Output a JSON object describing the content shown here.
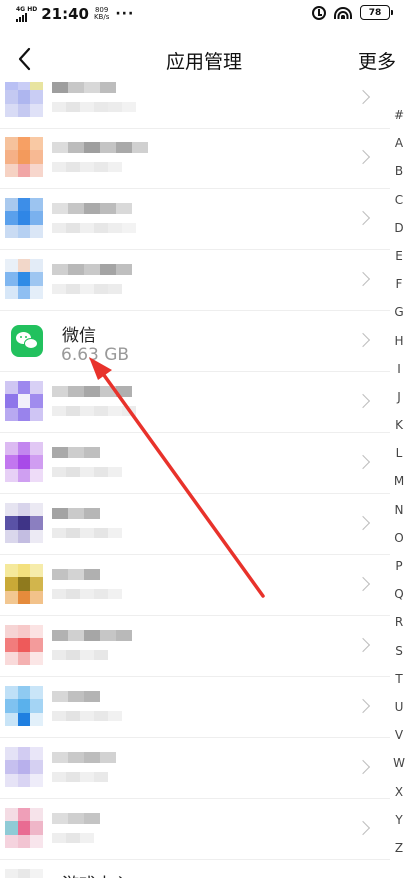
{
  "status_bar": {
    "network": "4G HD",
    "time": "21:40",
    "speed_value": "809",
    "speed_unit": "KB/s",
    "more_dots": "···",
    "battery": "78"
  },
  "header": {
    "title": "应用管理",
    "more_label": "更多"
  },
  "apps": [
    {
      "label": "",
      "blurred": true
    },
    {
      "label": "",
      "blurred": true
    },
    {
      "label": "",
      "blurred": true
    },
    {
      "label": "",
      "blurred": true
    },
    {
      "label": "微信",
      "size": "6.63 GB",
      "blurred": false
    },
    {
      "label": "",
      "blurred": true
    },
    {
      "label": "",
      "blurred": true
    },
    {
      "label": "",
      "blurred": true
    },
    {
      "label": "",
      "blurred": true
    },
    {
      "label": "",
      "blurred": true
    },
    {
      "label": "",
      "blurred": true
    },
    {
      "label": "",
      "blurred": true
    },
    {
      "label": "",
      "blurred": true
    },
    {
      "label": "游戏中心",
      "blurred": false
    }
  ],
  "alphabet_index": [
    "#",
    "A",
    "B",
    "C",
    "D",
    "E",
    "F",
    "G",
    "H",
    "I",
    "J",
    "K",
    "L",
    "M",
    "N",
    "O",
    "P",
    "Q",
    "R",
    "S",
    "T",
    "U",
    "V",
    "W",
    "X",
    "Y",
    "Z"
  ],
  "colors": {
    "wechat_green": "#22c15e",
    "annotation_arrow": "#e8322b"
  }
}
